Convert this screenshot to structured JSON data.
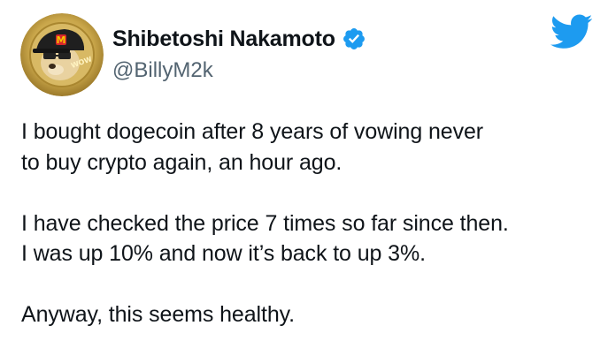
{
  "author": {
    "display_name": "Shibetoshi Nakamoto",
    "handle": "@BillyM2k",
    "verified": true,
    "avatar": {
      "icon": "doge-coin-avatar-icon",
      "badge_text": "WOW",
      "cap_letter": "M"
    }
  },
  "brand": {
    "icon": "twitter-bird-icon",
    "color": "#1d9bf0"
  },
  "colors": {
    "text": "#0f1419",
    "handle": "#536471",
    "verified_badge": "#1d9bf0",
    "avatar_gold": "#c9a64a"
  },
  "tweet": {
    "paragraphs": [
      {
        "lines": [
          "I bought dogecoin after 8 years of vowing never",
          "to buy crypto again, an hour ago."
        ]
      },
      {
        "lines": [
          "I have checked the price 7 times so far since then.",
          "I was up 10% and now it’s back to up 3%."
        ]
      },
      {
        "lines": [
          "Anyway, this seems healthy."
        ]
      }
    ]
  }
}
